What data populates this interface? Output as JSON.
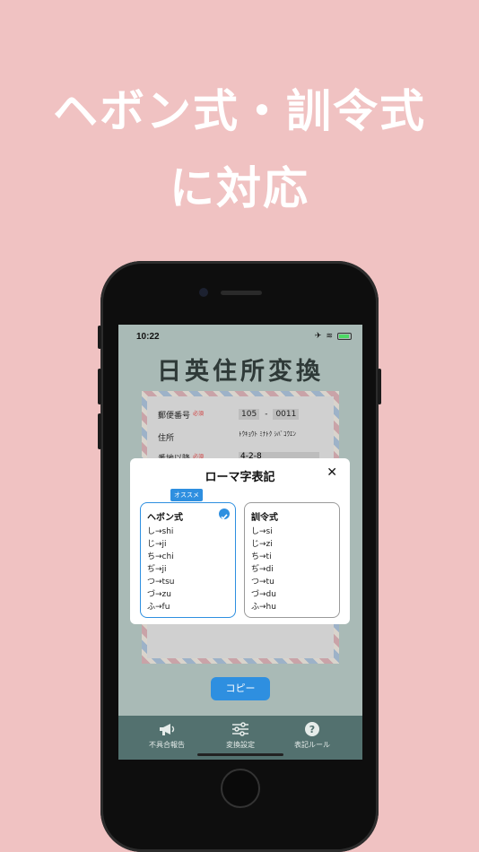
{
  "promo": {
    "line1": "ヘボン式・訓令式",
    "line2": "に対応"
  },
  "status": {
    "time": "10:22",
    "airplane": "✈",
    "wifi": "≋"
  },
  "app": {
    "title": "日英住所変換"
  },
  "form": {
    "postal_label": "郵便番号",
    "required": "必須",
    "postal_code_1": "105",
    "dash": "-",
    "postal_code_2": "0011",
    "address_label": "住所",
    "address_value": "ﾄｳｷｮｳﾄ ﾐﾅﾄｸ ｼﾊﾞｺｳｴﾝ",
    "number_label": "番地以降",
    "number_value": "4-2-8"
  },
  "modal": {
    "title": "ローマ字表記",
    "close": "✕",
    "recommended_badge": "オススメ",
    "hepburn": {
      "title": "ヘボン式",
      "items": [
        "し→shi",
        "じ→ji",
        "ち→chi",
        "ぢ→ji",
        "つ→tsu",
        "づ→zu",
        "ふ→fu"
      ]
    },
    "kunrei": {
      "title": "訓令式",
      "items": [
        "し→si",
        "じ→zi",
        "ち→ti",
        "ぢ→di",
        "つ→tu",
        "づ→du",
        "ふ→hu"
      ]
    }
  },
  "copy_button": "コピー",
  "tabs": [
    {
      "label": "不具合報告",
      "icon": "megaphone-icon"
    },
    {
      "label": "変換設定",
      "icon": "sliders-icon"
    },
    {
      "label": "表記ルール",
      "icon": "help-icon"
    }
  ]
}
